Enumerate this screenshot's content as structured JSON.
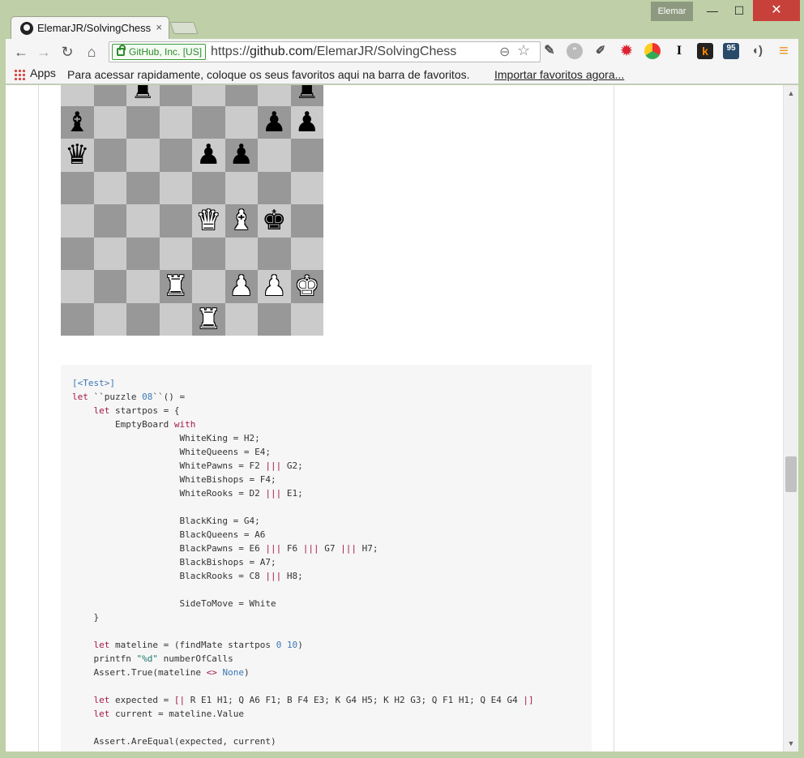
{
  "window": {
    "user": "Elemar",
    "controls": {
      "minimize": "—",
      "maximize": "☐",
      "close": "✕"
    }
  },
  "tab": {
    "title": "ElemarJR/SolvingChess",
    "close": "×"
  },
  "toolbar": {
    "back": "←",
    "forward": "→",
    "reload": "↻",
    "home": "⌂",
    "ev_badge": "GitHub, Inc. [US]",
    "url_scheme": "https://",
    "url_host": "github.com",
    "url_path": "/ElemarJR/SolvingChess",
    "zoom_icon": "⊖",
    "star_icon": "☆",
    "menu_icon": "≡",
    "ext_badge_count": "95"
  },
  "bookmarks": {
    "apps_label": "Apps",
    "hint": "Para acessar rapidamente, coloque os seus favoritos aqui na barra de favoritos.",
    "import_link": "Importar favoritos agora..."
  },
  "board": {
    "light_color": "#cbcbcb",
    "dark_color": "#989898",
    "squares": [
      [
        "",
        "",
        "bR",
        "",
        "",
        "",
        "",
        "bR"
      ],
      [
        "bB",
        "",
        "",
        "",
        "",
        "",
        "bP",
        "bP"
      ],
      [
        "bQ",
        "",
        "",
        "",
        "bP",
        "bP",
        "",
        ""
      ],
      [
        "",
        "",
        "",
        "",
        "",
        "",
        "",
        ""
      ],
      [
        "",
        "",
        "",
        "",
        "wQ",
        "wB",
        "bK",
        ""
      ],
      [
        "",
        "",
        "",
        "",
        "",
        "",
        "",
        ""
      ],
      [
        "",
        "",
        "",
        "wR",
        "",
        "wP",
        "wP",
        "wK"
      ],
      [
        "",
        "",
        "",
        "",
        "wR",
        "",
        "",
        ""
      ]
    ]
  },
  "code_lines": [
    [
      {
        "c": "a",
        "t": "[<Test>]"
      }
    ],
    [
      {
        "c": "k",
        "t": "let"
      },
      {
        "c": "",
        "t": " ``puzzle "
      },
      {
        "c": "n",
        "t": "08"
      },
      {
        "c": "",
        "t": "``() ="
      }
    ],
    [
      {
        "c": "",
        "t": "    "
      },
      {
        "c": "k",
        "t": "let"
      },
      {
        "c": "",
        "t": " startpos = {"
      }
    ],
    [
      {
        "c": "",
        "t": "        EmptyBoard "
      },
      {
        "c": "k",
        "t": "with"
      }
    ],
    [
      {
        "c": "",
        "t": "                    WhiteKing = H2;"
      }
    ],
    [
      {
        "c": "",
        "t": "                    WhiteQueens = E4;"
      }
    ],
    [
      {
        "c": "",
        "t": "                    WhitePawns = F2 "
      },
      {
        "c": "k",
        "t": "|||"
      },
      {
        "c": "",
        "t": " G2;"
      }
    ],
    [
      {
        "c": "",
        "t": "                    WhiteBishops = F4;"
      }
    ],
    [
      {
        "c": "",
        "t": "                    WhiteRooks = D2 "
      },
      {
        "c": "k",
        "t": "|||"
      },
      {
        "c": "",
        "t": " E1;"
      }
    ],
    [
      {
        "c": "",
        "t": ""
      }
    ],
    [
      {
        "c": "",
        "t": "                    BlackKing = G4;"
      }
    ],
    [
      {
        "c": "",
        "t": "                    BlackQueens = A6"
      }
    ],
    [
      {
        "c": "",
        "t": "                    BlackPawns = E6 "
      },
      {
        "c": "k",
        "t": "|||"
      },
      {
        "c": "",
        "t": " F6 "
      },
      {
        "c": "k",
        "t": "|||"
      },
      {
        "c": "",
        "t": " G7 "
      },
      {
        "c": "k",
        "t": "|||"
      },
      {
        "c": "",
        "t": " H7;"
      }
    ],
    [
      {
        "c": "",
        "t": "                    BlackBishops = A7;"
      }
    ],
    [
      {
        "c": "",
        "t": "                    BlackRooks = C8 "
      },
      {
        "c": "k",
        "t": "|||"
      },
      {
        "c": "",
        "t": " H8;"
      }
    ],
    [
      {
        "c": "",
        "t": ""
      }
    ],
    [
      {
        "c": "",
        "t": "                    SideToMove = White"
      }
    ],
    [
      {
        "c": "",
        "t": "    }"
      }
    ],
    [
      {
        "c": "",
        "t": ""
      }
    ],
    [
      {
        "c": "",
        "t": "    "
      },
      {
        "c": "k",
        "t": "let"
      },
      {
        "c": "",
        "t": " mateline = (findMate startpos "
      },
      {
        "c": "n",
        "t": "0"
      },
      {
        "c": "",
        "t": " "
      },
      {
        "c": "n",
        "t": "10"
      },
      {
        "c": "",
        "t": ")"
      }
    ],
    [
      {
        "c": "",
        "t": "    printfn "
      },
      {
        "c": "s",
        "t": "\"%d\""
      },
      {
        "c": "",
        "t": " numberOfCalls"
      }
    ],
    [
      {
        "c": "",
        "t": "    Assert.True(mateline "
      },
      {
        "c": "k",
        "t": "<>"
      },
      {
        "c": "",
        "t": " "
      },
      {
        "c": "a",
        "t": "None"
      },
      {
        "c": "",
        "t": ")"
      }
    ],
    [
      {
        "c": "",
        "t": ""
      }
    ],
    [
      {
        "c": "",
        "t": "    "
      },
      {
        "c": "k",
        "t": "let"
      },
      {
        "c": "",
        "t": " expected = "
      },
      {
        "c": "k",
        "t": "[|"
      },
      {
        "c": "",
        "t": " R E1 H1; Q A6 F1; B F4 E3; K G4 H5; K H2 G3; Q F1 H1; Q E4 G4 "
      },
      {
        "c": "k",
        "t": "|]"
      }
    ],
    [
      {
        "c": "",
        "t": "    "
      },
      {
        "c": "k",
        "t": "let"
      },
      {
        "c": "",
        "t": " current = mateline.Value"
      }
    ],
    [
      {
        "c": "",
        "t": ""
      }
    ],
    [
      {
        "c": "",
        "t": "    Assert.AreEqual(expected, current)"
      }
    ]
  ]
}
